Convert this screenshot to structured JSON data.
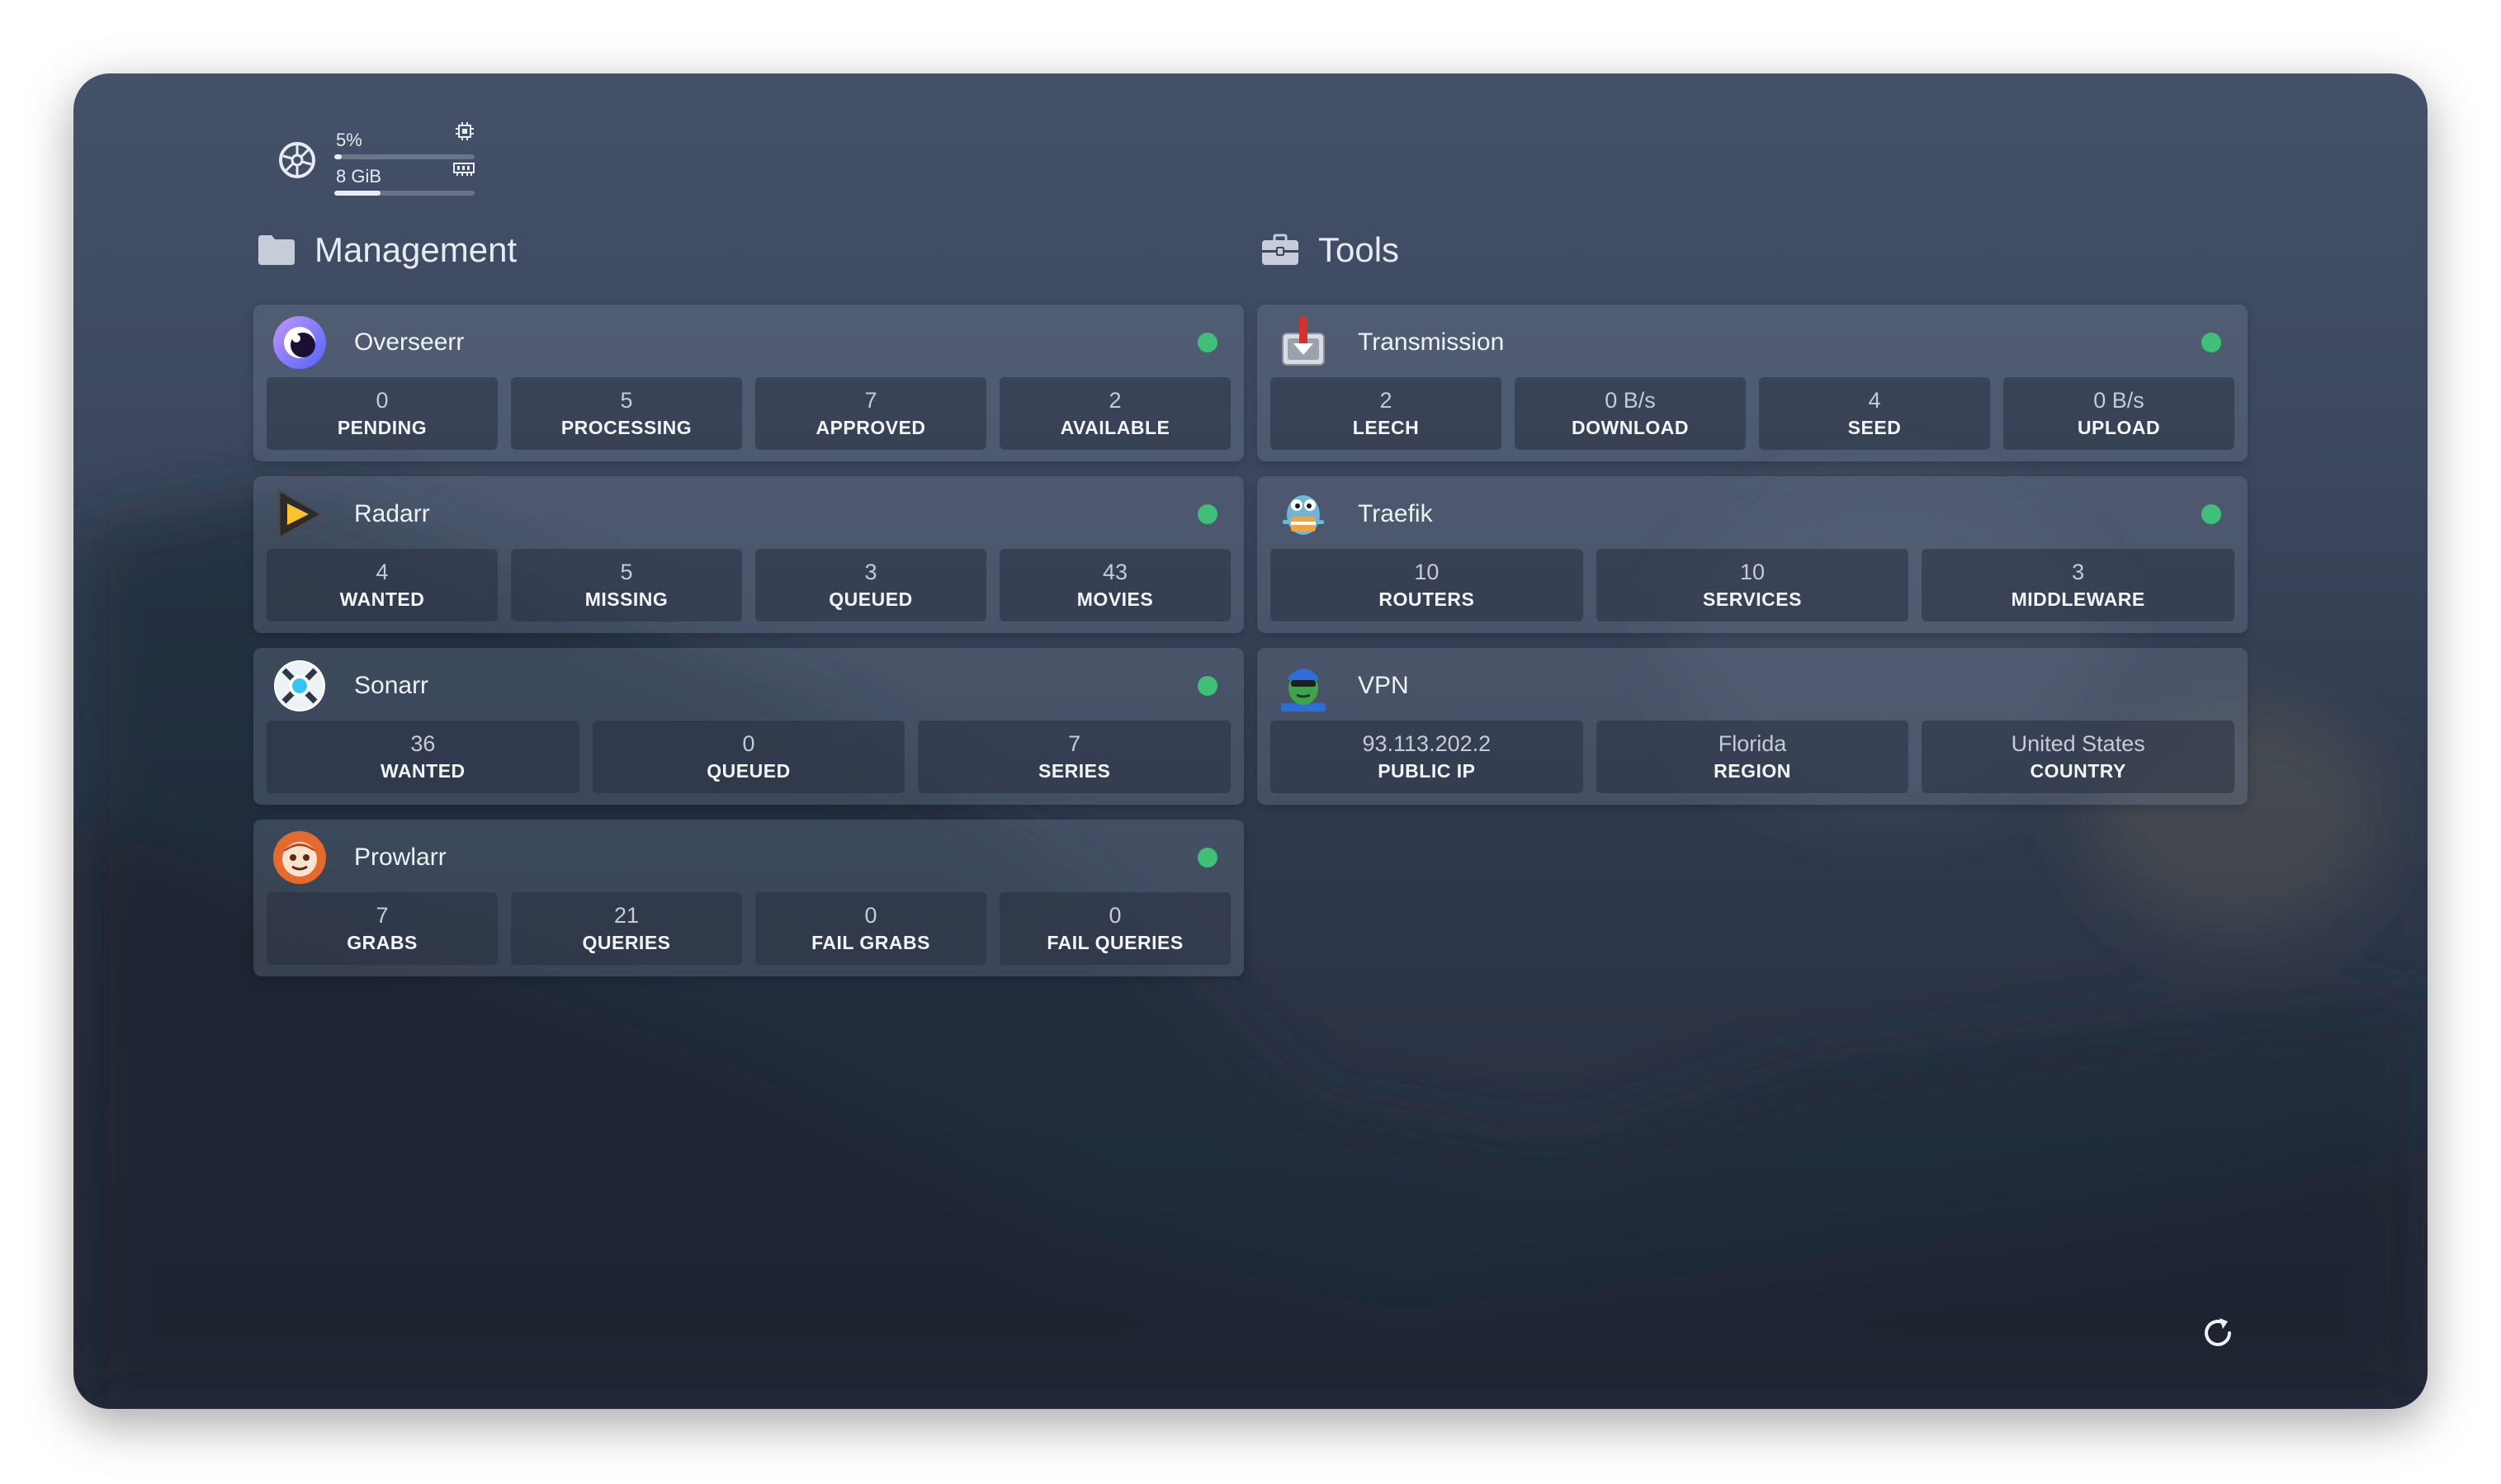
{
  "system": {
    "cpu_text": "5%",
    "cpu_fraction": 0.05,
    "memory_text": "8 GiB",
    "memory_fraction": 0.33,
    "cpu_icon": "cpu-icon",
    "memory_icon": "memory-icon",
    "cluster_icon": "kubernetes-icon"
  },
  "groups": [
    {
      "title": "Management",
      "icon": "folder-icon",
      "services": [
        {
          "name": "Overseerr",
          "logo": "overseerr-logo",
          "status_color": "#3fbf78",
          "stats": [
            {
              "value": "0",
              "label": "PENDING"
            },
            {
              "value": "5",
              "label": "PROCESSING"
            },
            {
              "value": "7",
              "label": "APPROVED"
            },
            {
              "value": "2",
              "label": "AVAILABLE"
            }
          ]
        },
        {
          "name": "Radarr",
          "logo": "radarr-logo",
          "status_color": "#3fbf78",
          "stats": [
            {
              "value": "4",
              "label": "WANTED"
            },
            {
              "value": "5",
              "label": "MISSING"
            },
            {
              "value": "3",
              "label": "QUEUED"
            },
            {
              "value": "43",
              "label": "MOVIES"
            }
          ]
        },
        {
          "name": "Sonarr",
          "logo": "sonarr-logo",
          "status_color": "#3fbf78",
          "stats": [
            {
              "value": "36",
              "label": "WANTED"
            },
            {
              "value": "0",
              "label": "QUEUED"
            },
            {
              "value": "7",
              "label": "SERIES"
            }
          ]
        },
        {
          "name": "Prowlarr",
          "logo": "prowlarr-logo",
          "status_color": "#3fbf78",
          "stats": [
            {
              "value": "7",
              "label": "GRABS"
            },
            {
              "value": "21",
              "label": "QUERIES"
            },
            {
              "value": "0",
              "label": "FAIL GRABS"
            },
            {
              "value": "0",
              "label": "FAIL QUERIES"
            }
          ]
        }
      ]
    },
    {
      "title": "Tools",
      "icon": "toolbox-icon",
      "services": [
        {
          "name": "Transmission",
          "logo": "transmission-logo",
          "status_color": "#3fbf78",
          "stats": [
            {
              "value": "2",
              "label": "LEECH"
            },
            {
              "value": "0 B/s",
              "label": "DOWNLOAD"
            },
            {
              "value": "4",
              "label": "SEED"
            },
            {
              "value": "0 B/s",
              "label": "UPLOAD"
            }
          ]
        },
        {
          "name": "Traefik",
          "logo": "traefik-logo",
          "status_color": "#3fbf78",
          "stats": [
            {
              "value": "10",
              "label": "ROUTERS"
            },
            {
              "value": "10",
              "label": "SERVICES"
            },
            {
              "value": "3",
              "label": "MIDDLEWARE"
            }
          ]
        },
        {
          "name": "VPN",
          "logo": "gluetun-logo",
          "status_color": null,
          "stats": [
            {
              "value": "93.113.202.2",
              "label": "PUBLIC IP"
            },
            {
              "value": "Florida",
              "label": "REGION"
            },
            {
              "value": "United States",
              "label": "COUNTRY"
            }
          ]
        }
      ]
    }
  ],
  "footer": {
    "refresh_icon": "refresh-icon"
  }
}
